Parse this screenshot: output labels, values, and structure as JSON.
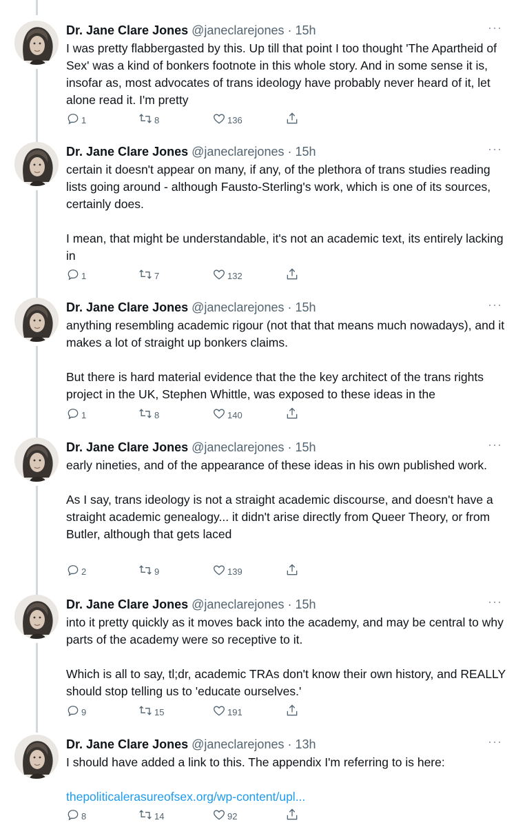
{
  "more_label": "···",
  "tweets": [
    {
      "name": "Dr. Jane Clare Jones",
      "handle": "@janeclarejones",
      "time": "15h",
      "paragraphs": [
        "I was pretty flabbergasted by this. Up till that point I too thought 'The Apartheid of Sex' was a kind of bonkers footnote in this whole story. And in some sense it is, insofar as, most advocates of trans ideology have probably never heard of it, let alone read it. I'm pretty"
      ],
      "replies": "1",
      "retweets": "8",
      "likes": "136"
    },
    {
      "name": "Dr. Jane Clare Jones",
      "handle": "@janeclarejones",
      "time": "15h",
      "paragraphs": [
        "certain it doesn't appear on many, if any, of the plethora of trans studies reading lists going around - although Fausto-Sterling's work, which is one of its sources, certainly does.",
        "I mean, that might be understandable, it's not an academic text, its entirely lacking in"
      ],
      "replies": "1",
      "retweets": "7",
      "likes": "132"
    },
    {
      "name": "Dr. Jane Clare Jones",
      "handle": "@janeclarejones",
      "time": "15h",
      "paragraphs": [
        "anything resembling academic rigour (not that that means much nowadays), and it makes a lot of straight up bonkers claims.",
        "But there is hard material evidence that the the key architect of the trans rights project in the UK, Stephen Whittle, was exposed to these ideas in the"
      ],
      "replies": "1",
      "retweets": "8",
      "likes": "140"
    },
    {
      "name": "Dr. Jane Clare Jones",
      "handle": "@janeclarejones",
      "time": "15h",
      "paragraphs": [
        "early nineties, and of the appearance of these ideas in his own published work.",
        "As I say, trans ideology is not a straight academic discourse, and doesn't have a straight academic genealogy... it didn't arise directly from Queer Theory, or from Butler, although that gets laced"
      ],
      "replies": "2",
      "retweets": "9",
      "likes": "139"
    },
    {
      "name": "Dr. Jane Clare Jones",
      "handle": "@janeclarejones",
      "time": "15h",
      "paragraphs": [
        "into it pretty quickly as it moves back into the academy, and may be central to why parts of the academy were so receptive to it.",
        "Which is all to say, tl;dr, academic TRAs don't know their own history, and REALLY should stop telling us to 'educate ourselves.'"
      ],
      "replies": "9",
      "retweets": "15",
      "likes": "191"
    },
    {
      "name": "Dr. Jane Clare Jones",
      "handle": "@janeclarejones",
      "time": "13h",
      "paragraphs": [
        "I should have added a link to this. The appendix I'm referring to is here:"
      ],
      "link": "thepoliticalerasureofsex.org/wp-content/upl...",
      "replies": "8",
      "retweets": "14",
      "likes": "92"
    }
  ]
}
